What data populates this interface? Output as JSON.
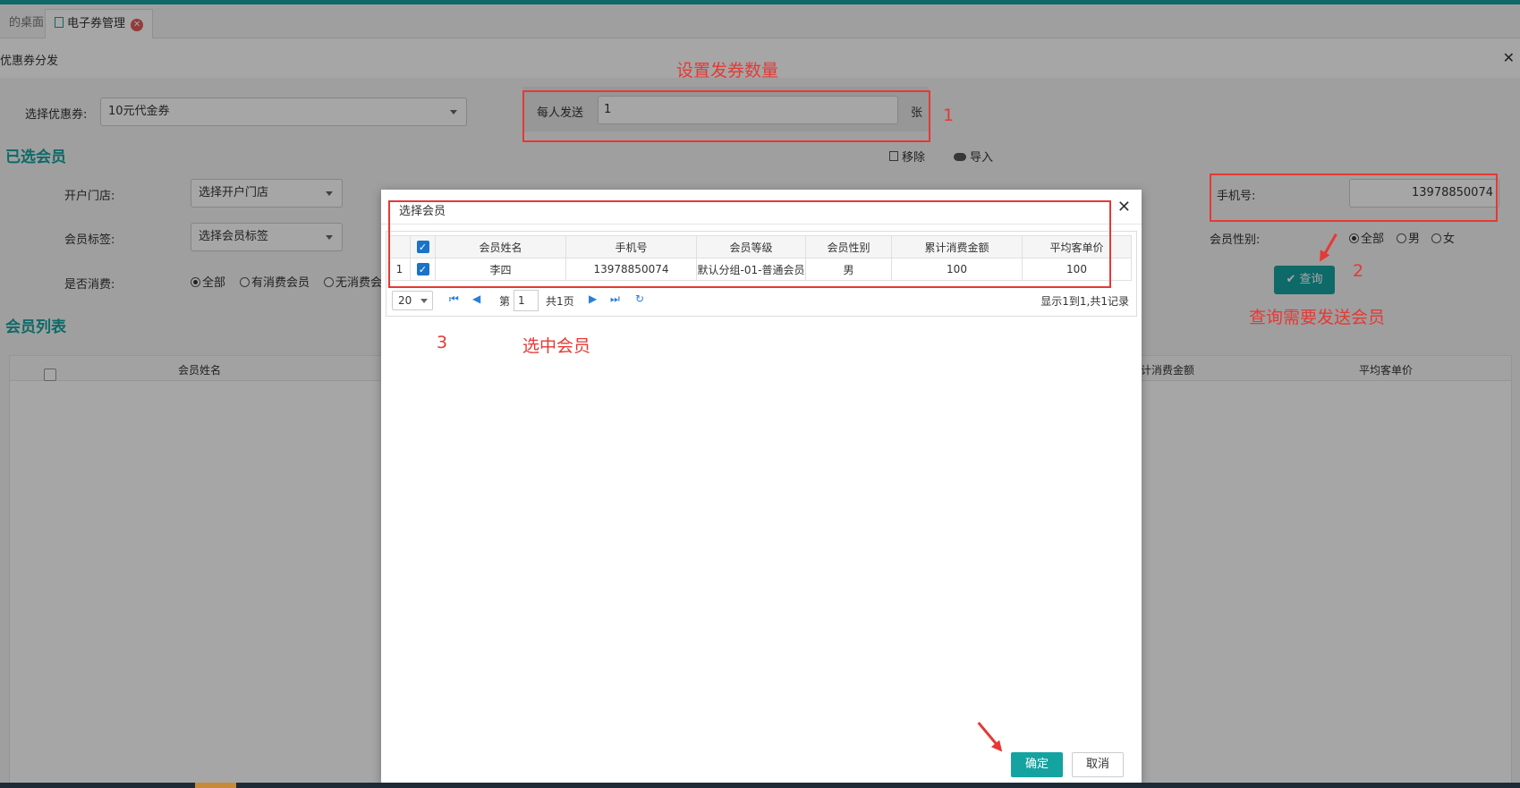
{
  "tabs": {
    "desktop": "的桌面",
    "active": "电子券管理",
    "close_icon": "✕"
  },
  "page": {
    "title": "优惠券分发",
    "close": "✕"
  },
  "form": {
    "coupon_label": "选择优惠券:",
    "coupon_value": "10元代金券",
    "per_send_label": "每人发送",
    "per_send_value": "1",
    "per_send_unit": "张"
  },
  "selected": {
    "title": "已选会员",
    "remove": "移除",
    "import": "导入"
  },
  "filters": {
    "store_label": "开户门店:",
    "store_value": "选择开户门店",
    "tag_label": "会员标签:",
    "tag_value": "选择会员标签",
    "consume_label": "是否消费:",
    "consume_options": [
      "全部",
      "有消费会员",
      "无消费会"
    ],
    "phone_label": "手机号:",
    "phone_value": "13978850074",
    "gender_label": "会员性别:",
    "gender_options": [
      "全部",
      "男",
      "女"
    ],
    "query_button": "查询"
  },
  "list": {
    "title": "会员列表",
    "columns": [
      "会员姓名",
      "计消费金额",
      "平均客单价"
    ]
  },
  "modal": {
    "title": "选择会员",
    "columns": [
      "会员姓名",
      "手机号",
      "会员等级",
      "会员性别",
      "累计消费金额",
      "平均客单价"
    ],
    "rows": [
      {
        "index": "1",
        "name": "李四",
        "phone": "13978850074",
        "level": "默认分组-01-普通会员",
        "gender": "男",
        "total": "100",
        "avg": "100"
      }
    ],
    "pager": {
      "page_size": "20",
      "page_prefix": "第",
      "page_value": "1",
      "page_total": "共1页",
      "summary": "显示1到1,共1记录"
    },
    "ok": "确定",
    "cancel": "取消"
  },
  "annotations": {
    "one": "1",
    "one_text": "设置发券数量",
    "two": "2",
    "two_text": "查询需要发送会员",
    "three": "3",
    "three_text": "选中会员"
  },
  "colors": {
    "accent": "#14a3a0",
    "annotation": "#e53935"
  }
}
